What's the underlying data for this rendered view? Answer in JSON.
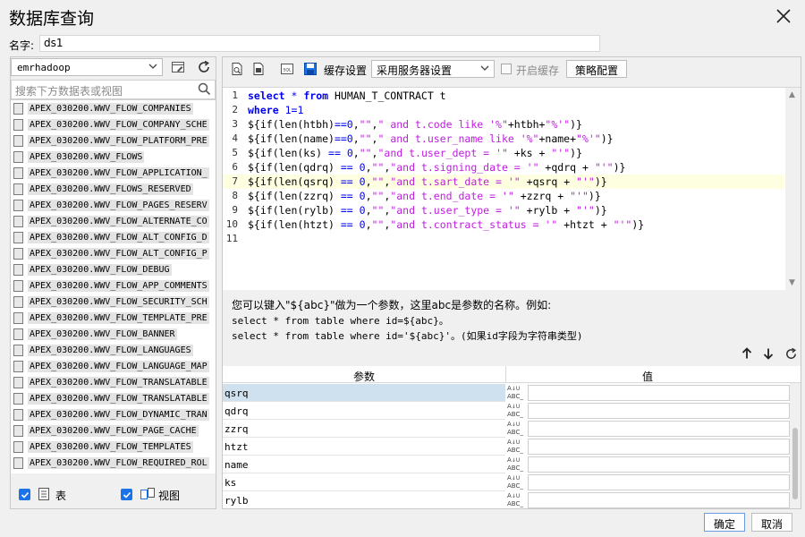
{
  "window": {
    "title": "数据库查询"
  },
  "name_field": {
    "label": "名字:",
    "value": "ds1"
  },
  "datasource": {
    "selected": "emrhadoop"
  },
  "search": {
    "placeholder": "搜索下方数据表或视图"
  },
  "tables": [
    "APEX_030200.WWV_FLOW_COMPANIES",
    "APEX_030200.WWV_FLOW_COMPANY_SCHE",
    "APEX_030200.WWV_FLOW_PLATFORM_PRE",
    "APEX_030200.WWV_FLOWS",
    "APEX_030200.WWV_FLOW_APPLICATION_",
    "APEX_030200.WWV_FLOWS_RESERVED",
    "APEX_030200.WWV_FLOW_PAGES_RESERV",
    "APEX_030200.WWV_FLOW_ALTERNATE_CO",
    "APEX_030200.WWV_FLOW_ALT_CONFIG_D",
    "APEX_030200.WWV_FLOW_ALT_CONFIG_P",
    "APEX_030200.WWV_FLOW_DEBUG",
    "APEX_030200.WWV_FLOW_APP_COMMENTS",
    "APEX_030200.WWV_FLOW_SECURITY_SCH",
    "APEX_030200.WWV_FLOW_TEMPLATE_PRE",
    "APEX_030200.WWV_FLOW_BANNER",
    "APEX_030200.WWV_FLOW_LANGUAGES",
    "APEX_030200.WWV_FLOW_LANGUAGE_MAP",
    "APEX_030200.WWV_FLOW_TRANSLATABLE",
    "APEX_030200.WWV_FLOW_TRANSLATABLE",
    "APEX_030200.WWV_FLOW_DYNAMIC_TRAN",
    "APEX_030200.WWV_FLOW_PAGE_CACHE",
    "APEX_030200.WWV_FLOW_TEMPLATES",
    "APEX_030200.WWV_FLOW_REQUIRED_ROL"
  ],
  "filters": {
    "tables_label": "表",
    "views_label": "视图"
  },
  "toolbar": {
    "cache_label": "缓存设置",
    "cache_mode": "采用服务器设置",
    "enable_cache_label": "开启缓存",
    "strategy_button": "策略配置"
  },
  "sql_lines": [
    "select * from HUMAN_T_CONTRACT t",
    "where 1=1",
    "${if(len(htbh)==0,\"\",\" and t.code like '%\"+htbh+\"%'\")}",
    "${if(len(name)==0,\"\",\" and t.user_name like '%\"+name+\"%'\")}",
    "${if(len(ks) == 0,\"\",\"and t.user_dept = '\" +ks + \"'\")}",
    "${if(len(qdrq) == 0,\"\",\"and t.signing_date = '\" +qdrq + \"'\")}",
    "${if(len(qsrq) == 0,\"\",\"and t.sart_date = '\" +qsrq + \"'\")}",
    "${if(len(zzrq) == 0,\"\",\"and t.end_date = '\" +zzrq + \"'\")}",
    "${if(len(rylb) == 0,\"\",\"and t.user_type = '\" +rylb + \"'\")}",
    "${if(len(htzt) == 0,\"\",\"and t.contract_status = '\" +htzt + \"'\")}",
    ""
  ],
  "hint": {
    "line1": "您可以键入\"${abc}\"做为一个参数，这里abc是参数的名称。例如:",
    "line2": "select * from table where id=${abc}。",
    "line3": "select * from table where id='${abc}'。(如果id字段为字符串类型)"
  },
  "params": {
    "headers": {
      "name": "参数",
      "value": "值"
    },
    "rows": [
      {
        "name": "qsrq",
        "value": ""
      },
      {
        "name": "qdrq",
        "value": ""
      },
      {
        "name": "zzrq",
        "value": ""
      },
      {
        "name": "htzt",
        "value": ""
      },
      {
        "name": "name",
        "value": ""
      },
      {
        "name": "ks",
        "value": ""
      },
      {
        "name": "rylb",
        "value": ""
      }
    ],
    "type_icon_text": "ABC"
  },
  "footer": {
    "ok": "确定",
    "cancel": "取消"
  }
}
